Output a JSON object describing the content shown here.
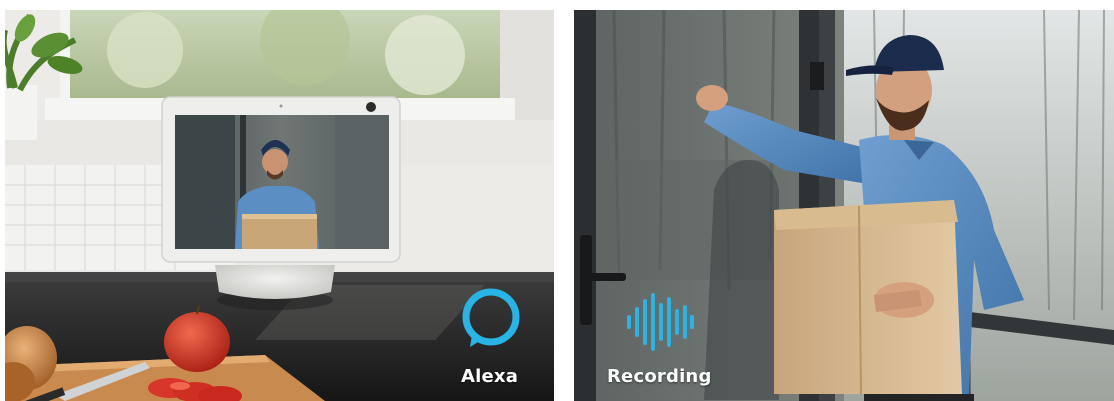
{
  "panels": [
    {
      "id": "left",
      "label": "Alexa",
      "icon": "alexa-ring-icon",
      "accent": "#29b4e6"
    },
    {
      "id": "right",
      "label": "Recording",
      "icon": "sound-wave-icon",
      "accent": "#29b4e6"
    }
  ]
}
